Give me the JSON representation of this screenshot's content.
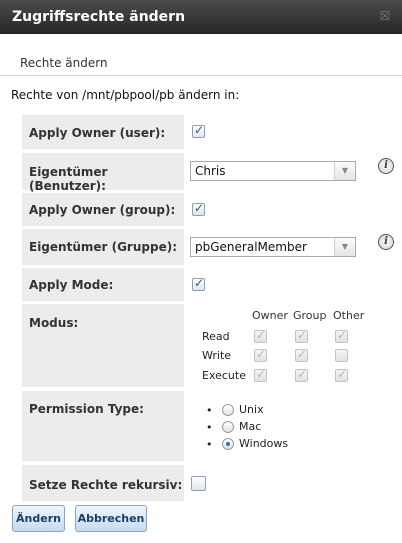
{
  "dialog": {
    "title": "Zugriffsrechte ändern",
    "close_glyph": "☒",
    "subtitle": "Rechte ändern",
    "intro": "Rechte von /mnt/pbpool/pb ändern in:"
  },
  "form": {
    "apply_owner_user": {
      "label": "Apply Owner (user):",
      "checked": true
    },
    "owner_user": {
      "label": "Eigentümer (Benutzer):",
      "value": "Chris",
      "info_icon": "info-icon"
    },
    "apply_owner_group": {
      "label": "Apply Owner (group):",
      "checked": true
    },
    "owner_group": {
      "label": "Eigentümer (Gruppe):",
      "value": "pbGeneralMember",
      "info_icon": "info-icon"
    },
    "apply_mode": {
      "label": "Apply Mode:",
      "checked": true
    },
    "mode": {
      "label": "Modus:",
      "columns": [
        "Owner",
        "Group",
        "Other"
      ],
      "rows": [
        {
          "label": "Read",
          "owner": true,
          "group": true,
          "other": true
        },
        {
          "label": "Write",
          "owner": true,
          "group": true,
          "other": false
        },
        {
          "label": "Execute",
          "owner": true,
          "group": true,
          "other": true
        }
      ]
    },
    "permission_type": {
      "label": "Permission Type:",
      "options": [
        "Unix",
        "Mac",
        "Windows"
      ],
      "selected": "Windows"
    },
    "recursive": {
      "label": "Setze Rechte rekursiv:",
      "checked": false
    }
  },
  "buttons": {
    "change": "Ändern",
    "cancel": "Abbrechen"
  },
  "colors": {
    "titlebar": "#333333",
    "label_bg": "#ececec",
    "button_border": "#7fa6cf"
  }
}
